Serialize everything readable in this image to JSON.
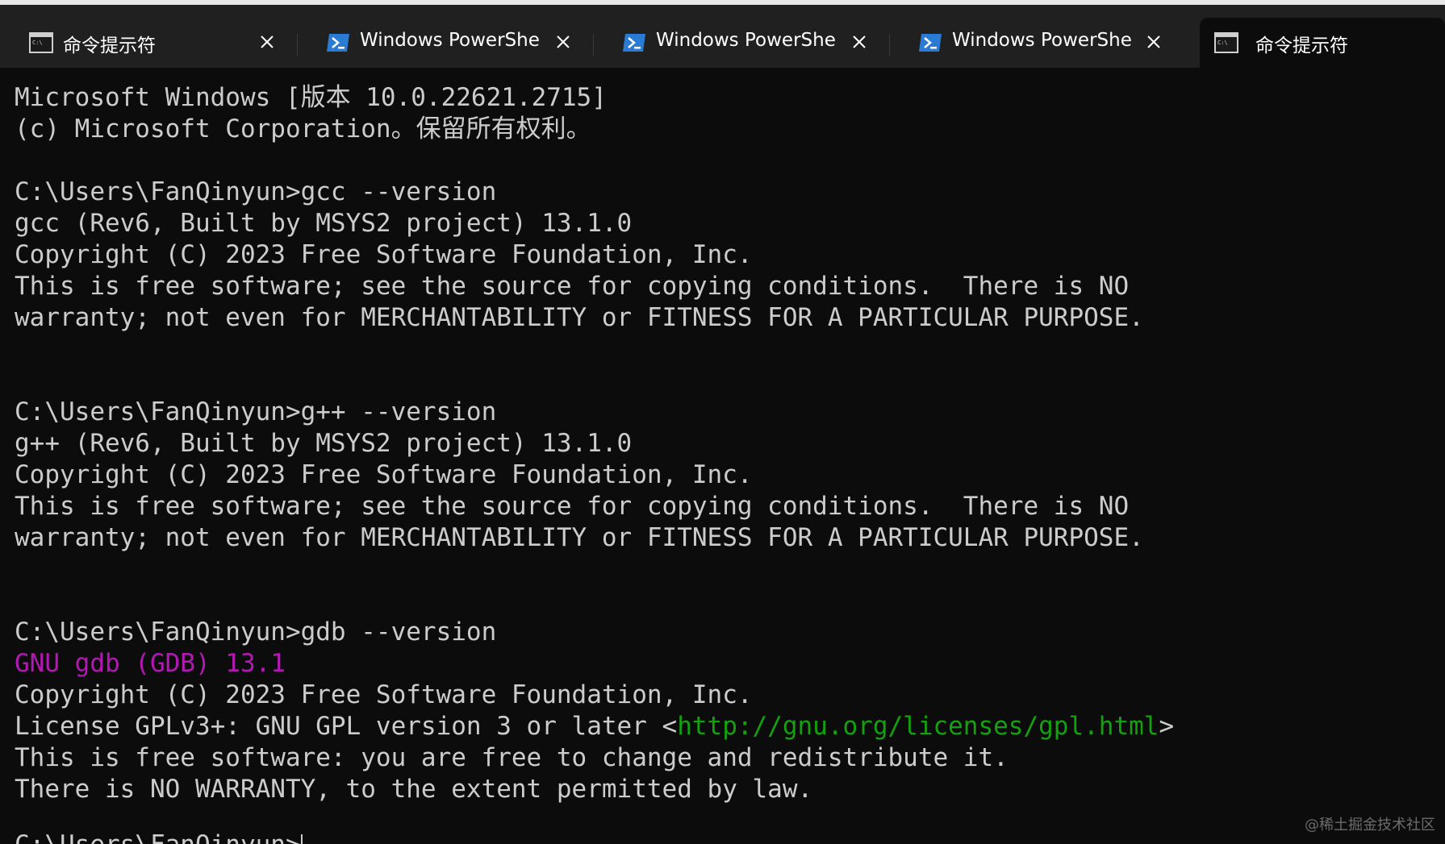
{
  "tabs": [
    {
      "label": "命令提示符",
      "icon": "cmd-icon",
      "active": false
    },
    {
      "label": "Windows PowerShell",
      "icon": "powershell-icon",
      "active": false
    },
    {
      "label": "Windows PowerShell",
      "icon": "powershell-icon",
      "active": false
    },
    {
      "label": "Windows PowerShell",
      "icon": "powershell-icon",
      "active": false
    },
    {
      "label": "命令提示符",
      "icon": "cmd-icon",
      "active": true
    }
  ],
  "terminal": {
    "lines": [
      "Microsoft Windows [版本 10.0.22621.2715]",
      "(c) Microsoft Corporation。保留所有权利。",
      "",
      "C:\\Users\\FanQinyun>gcc --version",
      "gcc (Rev6, Built by MSYS2 project) 13.1.0",
      "Copyright (C) 2023 Free Software Foundation, Inc.",
      "This is free software; see the source for copying conditions.  There is NO",
      "warranty; not even for MERCHANTABILITY or FITNESS FOR A PARTICULAR PURPOSE.",
      "",
      "",
      "C:\\Users\\FanQinyun>g++ --version",
      "g++ (Rev6, Built by MSYS2 project) 13.1.0",
      "Copyright (C) 2023 Free Software Foundation, Inc.",
      "This is free software; see the source for copying conditions.  There is NO",
      "warranty; not even for MERCHANTABILITY or FITNESS FOR A PARTICULAR PURPOSE.",
      "",
      "",
      "C:\\Users\\FanQinyun>gdb --version"
    ],
    "gdb_banner": "GNU gdb (GDB) 13.1",
    "gdb_copyright": "Copyright (C) 2023 Free Software Foundation, Inc.",
    "license_prefix": "License GPLv3+: GNU GPL version 3 or later <",
    "license_url": "http://gnu.org/licenses/gpl.html",
    "license_suffix": ">",
    "free_line": "This is free software: you are free to change and redistribute it.",
    "warranty_line": "There is NO WARRANTY, to the extent permitted by law.",
    "prompt_partial": "C:\\Users\\FanQinyun>"
  },
  "colors": {
    "background": "#0c0c0c",
    "text": "#cccccc",
    "gdb_banner": "#b418b4",
    "link": "#13a10e",
    "tabbar": "#202020"
  },
  "watermark": "@稀土掘金技术社区"
}
